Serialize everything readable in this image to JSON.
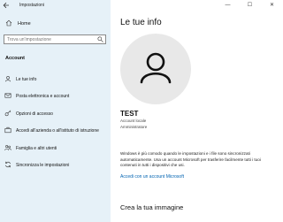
{
  "window": {
    "title": "Impostazioni",
    "back_icon": "arrow-left-icon",
    "controls": {
      "minimize": "—",
      "maximize": "☐",
      "close": "✕"
    }
  },
  "sidebar": {
    "home": {
      "label": "Home",
      "icon": "home-icon"
    },
    "search": {
      "placeholder": "Trova un'impostazione",
      "icon": "search-icon"
    },
    "section_title": "Account",
    "items": [
      {
        "label": "Le tue info",
        "icon": "person-card-icon",
        "selected": true
      },
      {
        "label": "Posta elettronica e account",
        "icon": "mail-icon",
        "selected": false
      },
      {
        "label": "Opzioni di accesso",
        "icon": "key-icon",
        "selected": false
      },
      {
        "label": "Accedi all'azienda o all'istituto di istruzione",
        "icon": "briefcase-icon",
        "selected": false
      },
      {
        "label": "Famiglia e altri utenti",
        "icon": "people-icon",
        "selected": false
      },
      {
        "label": "Sincronizza le impostazioni",
        "icon": "sync-icon",
        "selected": false
      }
    ]
  },
  "main": {
    "title": "Le tue info",
    "user_name": "TEST",
    "account_type": "Account locale",
    "account_role": "Amministratore",
    "description": "Windows è più comodo quando le impostazioni e i file sono sincronizzati automaticamente. Usa un account Microsoft per trasferire facilmente tutti i tuoi contenuti in tutti i dispositivi che usi.",
    "link": "Accedi con un account Microsoft",
    "section2_title": "Crea la tua immagine"
  },
  "colors": {
    "sidebar_bg": "#e6f1f8",
    "link": "#0063b1",
    "avatar_bg": "#e8e8e8"
  }
}
